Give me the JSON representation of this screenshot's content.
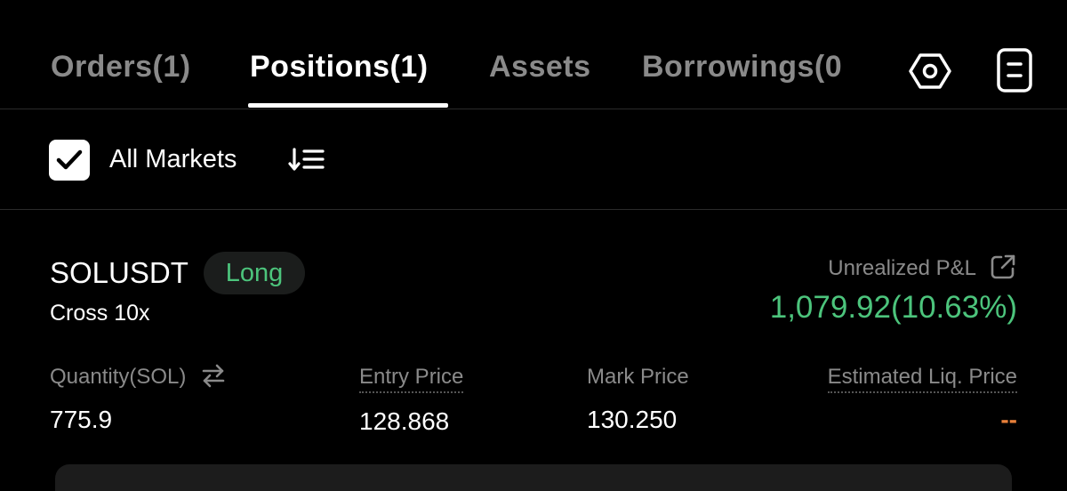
{
  "tabs": {
    "orders": "Orders(1)",
    "positions": "Positions(1)",
    "assets": "Assets",
    "borrowings": "Borrowings(0"
  },
  "filter": {
    "all_markets_label": "All Markets",
    "all_markets_checked": true
  },
  "position": {
    "symbol": "SOLUSDT",
    "side": "Long",
    "margin_mode": "Cross 10x",
    "unrealized_pnl_label": "Unrealized P&L",
    "unrealized_pnl_value": "1,079.92(10.63%)",
    "quantity_label": "Quantity(SOL)",
    "quantity_value": "775.9",
    "entry_price_label": "Entry Price",
    "entry_price_value": "128.868",
    "mark_price_label": "Mark Price",
    "mark_price_value": "130.250",
    "liq_price_label": "Estimated Liq. Price",
    "liq_price_value": "--"
  },
  "colors": {
    "background": "#000000",
    "positive": "#4cc47c",
    "muted": "#8a8a8a",
    "warning": "#e8803a"
  },
  "icons": {
    "settings": "settings-hexagon-icon",
    "document": "document-icon",
    "sort": "sort-icon",
    "share": "external-link-icon",
    "swap": "swap-arrows-icon",
    "check": "check-icon"
  }
}
